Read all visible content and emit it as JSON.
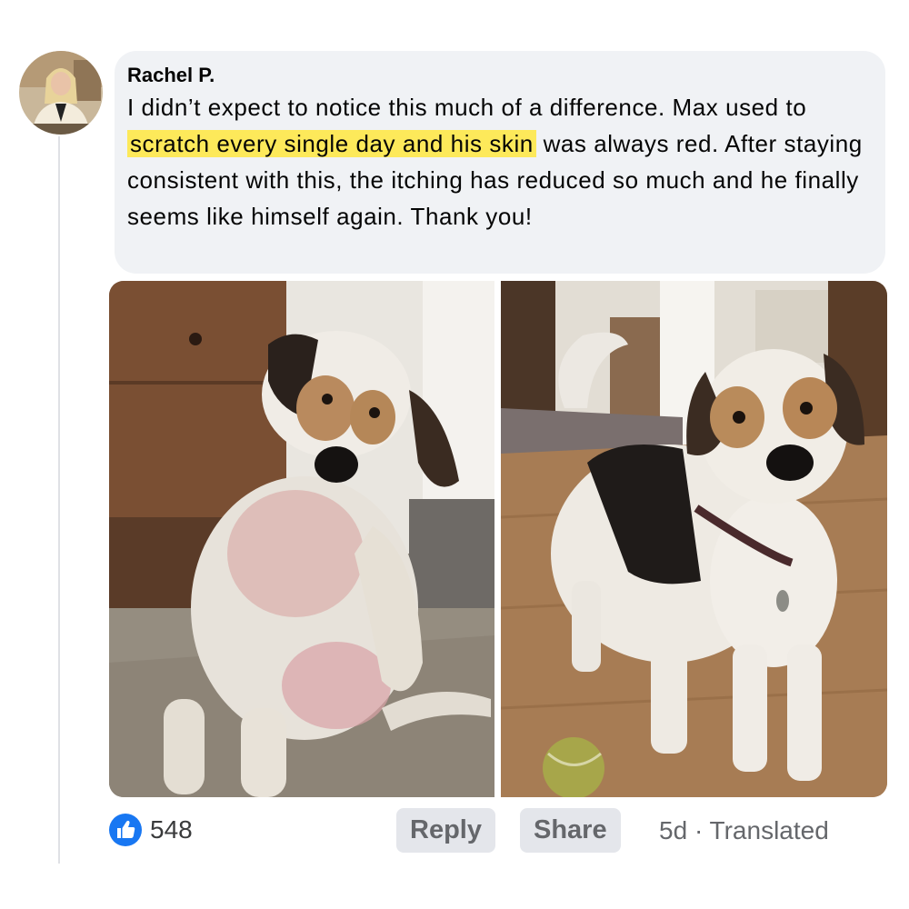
{
  "comment": {
    "author": "Rachel P.",
    "text_before": "I didn’t expect to notice this much of a difference. Max used to",
    "text_highlight": "scratch every single day and his skin",
    "text_after": "was always red. After staying consistent with this, the itching has reduced so much and he finally seems like himself again. Thank you!",
    "highlight_color": "#fde95a",
    "bubble_color": "#f0f2f5"
  },
  "photos": {
    "before_icon": "dog-scratching-photo",
    "after_icon": "dog-standing-with-ball-photo"
  },
  "actions": {
    "like_icon": "thumbs-up-icon",
    "like_icon_color": "#1877f2",
    "like_count": "548",
    "reply_label": "Reply",
    "share_label": "Share",
    "timestamp": "5d",
    "separator": "·",
    "translated_label": "Translated"
  }
}
